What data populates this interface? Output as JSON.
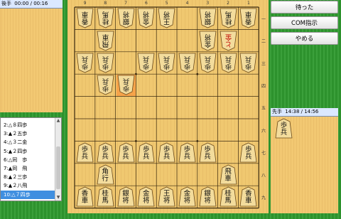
{
  "gote": {
    "label": "後手",
    "time": "00:00 / 00:16"
  },
  "sente": {
    "label": "先手",
    "time": "14:38 / 14:56"
  },
  "buttons": {
    "undo": "待った",
    "hint": "COM指示",
    "quit": "やめる"
  },
  "moves": [
    "2:△８四歩",
    "3:▲２五歩",
    "4:△３二金",
    "5:▲２四歩",
    "6:△同　歩",
    "7:▲同　飛",
    "8:▲２三歩",
    "9:▲２八飛",
    "10:△７四歩"
  ],
  "selected_move": 8,
  "file_labels": [
    "9",
    "8",
    "7",
    "6",
    "5",
    "4",
    "3",
    "2",
    "1"
  ],
  "rank_labels": [
    "一",
    "二",
    "三",
    "四",
    "五",
    "六",
    "七",
    "八",
    "九"
  ],
  "highlight_square": {
    "file": 7,
    "rank": 4
  },
  "pieces": [
    {
      "file": 9,
      "rank": 1,
      "side": "gote",
      "chars": [
        "香",
        "車"
      ]
    },
    {
      "file": 8,
      "rank": 1,
      "side": "gote",
      "chars": [
        "桂",
        "馬"
      ]
    },
    {
      "file": 7,
      "rank": 1,
      "side": "gote",
      "chars": [
        "銀",
        "将"
      ]
    },
    {
      "file": 6,
      "rank": 1,
      "side": "gote",
      "chars": [
        "金",
        "将"
      ]
    },
    {
      "file": 5,
      "rank": 1,
      "side": "gote",
      "chars": [
        "王",
        "将"
      ]
    },
    {
      "file": 3,
      "rank": 1,
      "side": "gote",
      "chars": [
        "銀",
        "将"
      ]
    },
    {
      "file": 2,
      "rank": 1,
      "side": "gote",
      "chars": [
        "桂",
        "馬"
      ]
    },
    {
      "file": 1,
      "rank": 1,
      "side": "gote",
      "chars": [
        "香",
        "車"
      ]
    },
    {
      "file": 8,
      "rank": 2,
      "side": "gote",
      "chars": [
        "飛",
        "車"
      ]
    },
    {
      "file": 3,
      "rank": 2,
      "side": "gote",
      "chars": [
        "金",
        "将"
      ]
    },
    {
      "file": 2,
      "rank": 2,
      "side": "gote",
      "chars": [
        "と",
        "金"
      ],
      "promoted": true
    },
    {
      "file": 9,
      "rank": 3,
      "side": "gote",
      "chars": [
        "歩",
        "兵"
      ]
    },
    {
      "file": 8,
      "rank": 3,
      "side": "gote",
      "chars": [
        "歩",
        "兵"
      ]
    },
    {
      "file": 6,
      "rank": 3,
      "side": "gote",
      "chars": [
        "歩",
        "兵"
      ]
    },
    {
      "file": 5,
      "rank": 3,
      "side": "gote",
      "chars": [
        "歩",
        "兵"
      ]
    },
    {
      "file": 4,
      "rank": 3,
      "side": "gote",
      "chars": [
        "歩",
        "兵"
      ]
    },
    {
      "file": 3,
      "rank": 3,
      "side": "gote",
      "chars": [
        "歩",
        "兵"
      ]
    },
    {
      "file": 2,
      "rank": 3,
      "side": "gote",
      "chars": [
        "歩",
        "兵"
      ]
    },
    {
      "file": 1,
      "rank": 3,
      "side": "gote",
      "chars": [
        "歩",
        "兵"
      ]
    },
    {
      "file": 8,
      "rank": 4,
      "side": "gote",
      "chars": [
        "歩",
        "兵"
      ]
    },
    {
      "file": 7,
      "rank": 4,
      "side": "gote",
      "chars": [
        "歩",
        "兵"
      ]
    },
    {
      "file": 9,
      "rank": 7,
      "side": "sente",
      "chars": [
        "歩",
        "兵"
      ]
    },
    {
      "file": 8,
      "rank": 7,
      "side": "sente",
      "chars": [
        "歩",
        "兵"
      ]
    },
    {
      "file": 7,
      "rank": 7,
      "side": "sente",
      "chars": [
        "歩",
        "兵"
      ]
    },
    {
      "file": 6,
      "rank": 7,
      "side": "sente",
      "chars": [
        "歩",
        "兵"
      ]
    },
    {
      "file": 5,
      "rank": 7,
      "side": "sente",
      "chars": [
        "歩",
        "兵"
      ]
    },
    {
      "file": 4,
      "rank": 7,
      "side": "sente",
      "chars": [
        "歩",
        "兵"
      ]
    },
    {
      "file": 3,
      "rank": 7,
      "side": "sente",
      "chars": [
        "歩",
        "兵"
      ]
    },
    {
      "file": 1,
      "rank": 7,
      "side": "sente",
      "chars": [
        "歩",
        "兵"
      ]
    },
    {
      "file": 8,
      "rank": 8,
      "side": "sente",
      "chars": [
        "角",
        "行"
      ]
    },
    {
      "file": 2,
      "rank": 8,
      "side": "sente",
      "chars": [
        "飛",
        "車"
      ]
    },
    {
      "file": 9,
      "rank": 9,
      "side": "sente",
      "chars": [
        "香",
        "車"
      ]
    },
    {
      "file": 8,
      "rank": 9,
      "side": "sente",
      "chars": [
        "桂",
        "馬"
      ]
    },
    {
      "file": 7,
      "rank": 9,
      "side": "sente",
      "chars": [
        "銀",
        "将"
      ]
    },
    {
      "file": 6,
      "rank": 9,
      "side": "sente",
      "chars": [
        "金",
        "将"
      ]
    },
    {
      "file": 5,
      "rank": 9,
      "side": "sente",
      "chars": [
        "王",
        "将"
      ]
    },
    {
      "file": 4,
      "rank": 9,
      "side": "sente",
      "chars": [
        "金",
        "将"
      ]
    },
    {
      "file": 3,
      "rank": 9,
      "side": "sente",
      "chars": [
        "銀",
        "将"
      ]
    },
    {
      "file": 2,
      "rank": 9,
      "side": "sente",
      "chars": [
        "桂",
        "馬"
      ]
    },
    {
      "file": 1,
      "rank": 9,
      "side": "sente",
      "chars": [
        "香",
        "車"
      ]
    }
  ],
  "sente_hand": [
    {
      "chars": [
        "歩",
        "兵"
      ]
    }
  ],
  "colors": {
    "grid": "#3a2a10",
    "highlight": "#f6a34a",
    "selected": "#3f8fe0",
    "background": "#2f9a2f"
  }
}
